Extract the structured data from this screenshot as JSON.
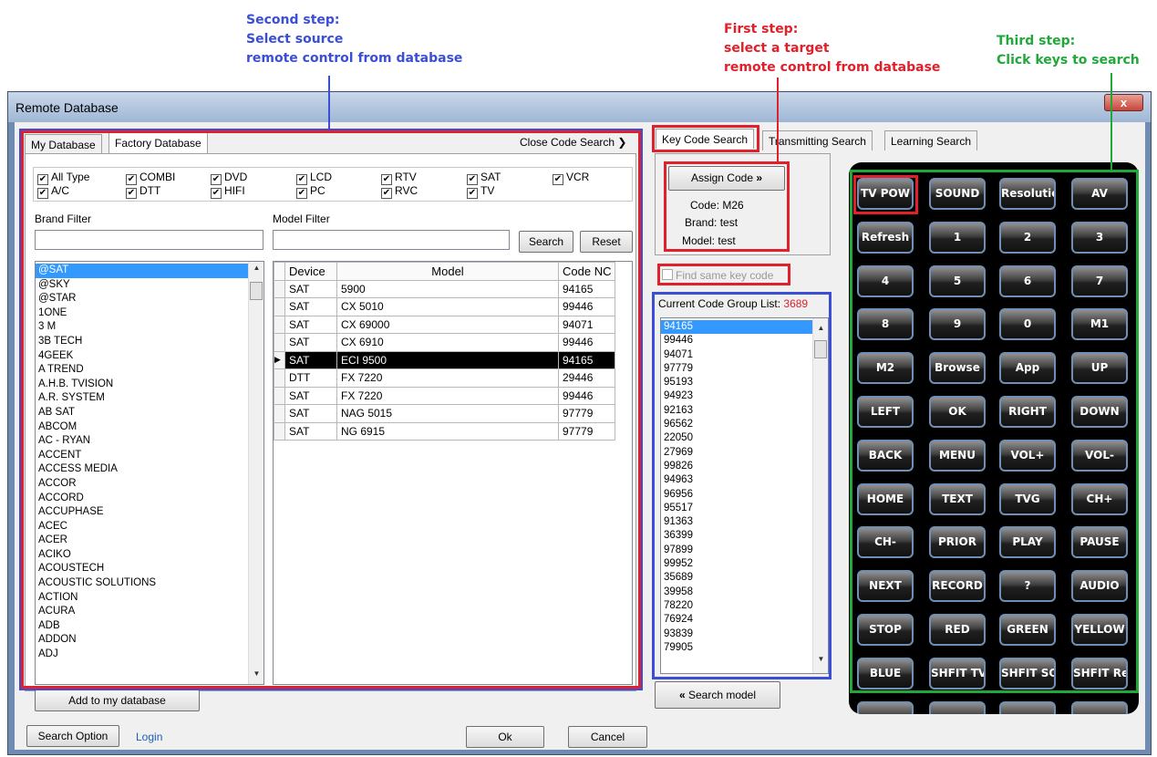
{
  "annotations": {
    "second_step": "Second step:\nSelect source\nremote control from database",
    "first_step": "First step:\n select a target\nremote control  from database",
    "third_step": "Third step:\nClick keys to search"
  },
  "window": {
    "title": "Remote Database",
    "close_label": "x"
  },
  "left_tabs": [
    "My Database",
    "Factory Database"
  ],
  "close_code_search": "Close Code Search",
  "type_filters": [
    {
      "label": "All Type",
      "checked": true
    },
    {
      "label": "COMBI",
      "checked": true
    },
    {
      "label": "DVD",
      "checked": true
    },
    {
      "label": "LCD",
      "checked": true
    },
    {
      "label": "RTV",
      "checked": true
    },
    {
      "label": "SAT",
      "checked": true
    },
    {
      "label": "VCR",
      "checked": true
    },
    {
      "label": "A/C",
      "checked": true
    },
    {
      "label": "DTT",
      "checked": true
    },
    {
      "label": "HIFI",
      "checked": true
    },
    {
      "label": "PC",
      "checked": true
    },
    {
      "label": "RVC",
      "checked": true
    },
    {
      "label": "TV",
      "checked": true
    }
  ],
  "brand_filter": {
    "label": "Brand Filter",
    "value": ""
  },
  "model_filter": {
    "label": "Model Filter",
    "value": ""
  },
  "search_label": "Search",
  "reset_label": "Reset",
  "brands": [
    "@SAT",
    "@SKY",
    "@STAR",
    "1ONE",
    "3 M",
    "3B TECH",
    "4GEEK",
    "A TREND",
    "A.H.B. TVISION",
    "A.R. SYSTEM",
    "AB SAT",
    "ABCOM",
    "AC - RYAN",
    "ACCENT",
    "ACCESS MEDIA",
    "ACCOR",
    "ACCORD",
    "ACCUPHASE",
    "ACEC",
    "ACER",
    "ACIKO",
    "ACOUSTECH",
    "ACOUSTIC SOLUTIONS",
    "ACTION",
    "ACURA",
    "ADB",
    "ADDON",
    "ADJ"
  ],
  "model_table": {
    "headers": [
      "Device",
      "Model",
      "Code NC"
    ],
    "rows": [
      [
        "SAT",
        "5900",
        "94165"
      ],
      [
        "SAT",
        "CX 5010",
        "99446"
      ],
      [
        "SAT",
        "CX 69000",
        "94071"
      ],
      [
        "SAT",
        "CX 6910",
        "99446"
      ],
      [
        "SAT",
        "ECI 9500",
        "94165"
      ],
      [
        "DTT",
        "FX 7220",
        "29446"
      ],
      [
        "SAT",
        "FX 7220",
        "99446"
      ],
      [
        "SAT",
        "NAG 5015",
        "97779"
      ],
      [
        "SAT",
        "NG 6915",
        "97779"
      ]
    ]
  },
  "add_to_db": "Add to my database",
  "right_tabs": [
    "Key Code Search",
    "Transmitting Search",
    "Learning Search"
  ],
  "assign": {
    "button": "Assign Code",
    "code_label": "Code:",
    "code_value": "M26",
    "brand_label": "Brand:",
    "brand_value": "test",
    "model_label": "Model:",
    "model_value": "test"
  },
  "find_same_key": "Find same key code",
  "code_group": {
    "label": "Current Code Group List:",
    "count": "3689"
  },
  "codes": [
    "94165",
    "99446",
    "94071",
    "97779",
    "95193",
    "94923",
    "92163",
    "96562",
    "22050",
    "27969",
    "99826",
    "94963",
    "96956",
    "95517",
    "91363",
    "36399",
    "97899",
    "99952",
    "35689",
    "39958",
    "78220",
    "76924",
    "93839",
    "79905"
  ],
  "search_model": "Search model",
  "remote_keys": [
    "TV POW",
    "SOUND",
    "Resolution",
    "AV",
    "Refresh",
    "1",
    "2",
    "3",
    "4",
    "5",
    "6",
    "7",
    "8",
    "9",
    "0",
    "M1",
    "M2",
    "Browse",
    "App",
    "UP",
    "LEFT",
    "OK",
    "RIGHT",
    "DOWN",
    "BACK",
    "MENU",
    "VOL+",
    "VOL-",
    "HOME",
    "TEXT",
    "TVG",
    "CH+",
    "CH-",
    "PRIOR",
    "PLAY",
    "PAUSE",
    "NEXT",
    "RECORD",
    "?",
    "AUDIO",
    "STOP",
    "RED",
    "GREEN",
    "YELLOW",
    "BLUE",
    "SHFIT TV POW",
    "SHFIT SOUND",
    "SHFIT Resolution"
  ],
  "footer": {
    "search_option": "Search Option",
    "login": "Login",
    "ok": "Ok",
    "cancel": "Cancel"
  },
  "colors": {
    "annotation_blue": "#3b4fd6",
    "annotation_red": "#e0202a",
    "annotation_green": "#22a83a"
  }
}
